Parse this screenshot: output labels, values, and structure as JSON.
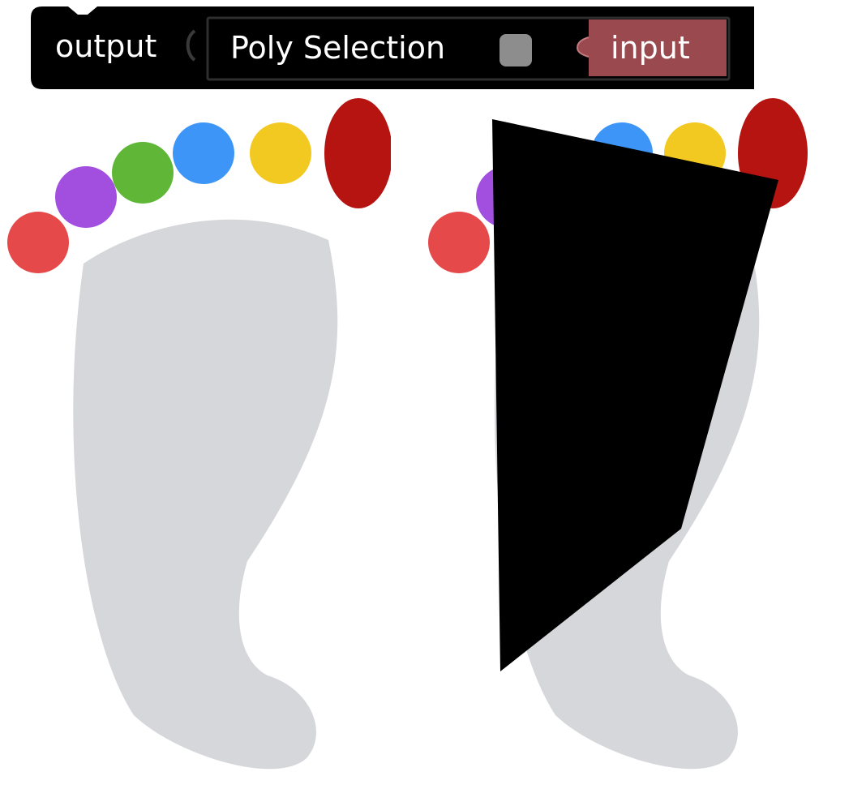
{
  "block": {
    "output_label": "output",
    "title": "Poly Selection",
    "input_label": "input"
  },
  "colors": {
    "block_bg": "#000000",
    "input_block_bg": "#9a4a4e",
    "toggle": "#8d8d8d",
    "foot": "#d6d7da",
    "mask": "#000000",
    "toe_red": "#e5494a",
    "toe_purple": "#a24fdf",
    "toe_green": "#5fb637",
    "toe_blue": "#3d95f7",
    "toe_yellow": "#f2c921",
    "toe_big": "#b51410"
  },
  "images": [
    {
      "name": "original-footprint",
      "icon": "footprint-icon"
    },
    {
      "name": "poly-selected-footprint",
      "icon": "footprint-icon"
    }
  ]
}
